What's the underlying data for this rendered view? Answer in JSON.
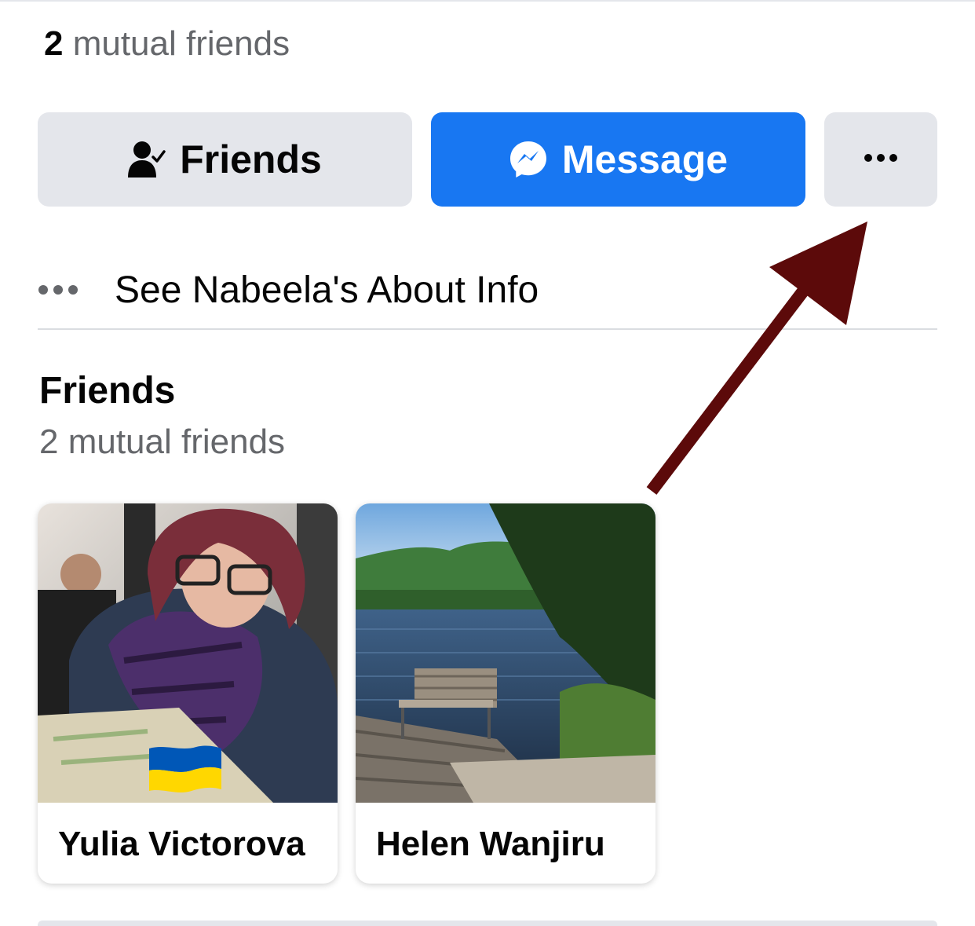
{
  "header": {
    "mutual_count": "2",
    "mutual_suffix": " mutual friends"
  },
  "actions": {
    "friends_label": "Friends",
    "message_label": "Message",
    "more_label": "•••"
  },
  "about": {
    "label": "See Nabeela's About Info"
  },
  "friends_section": {
    "title": "Friends",
    "subtitle": "2 mutual friends",
    "cards": [
      {
        "name": "Yulia Victorova",
        "badge_icon": "ukraine-flag-icon"
      },
      {
        "name": "Helen Wanjiru"
      }
    ]
  },
  "colors": {
    "primary_blue": "#1877f2",
    "secondary_button": "#e4e6eb",
    "annotation_arrow": "#5c0a0a",
    "muted_text": "#65676b"
  }
}
